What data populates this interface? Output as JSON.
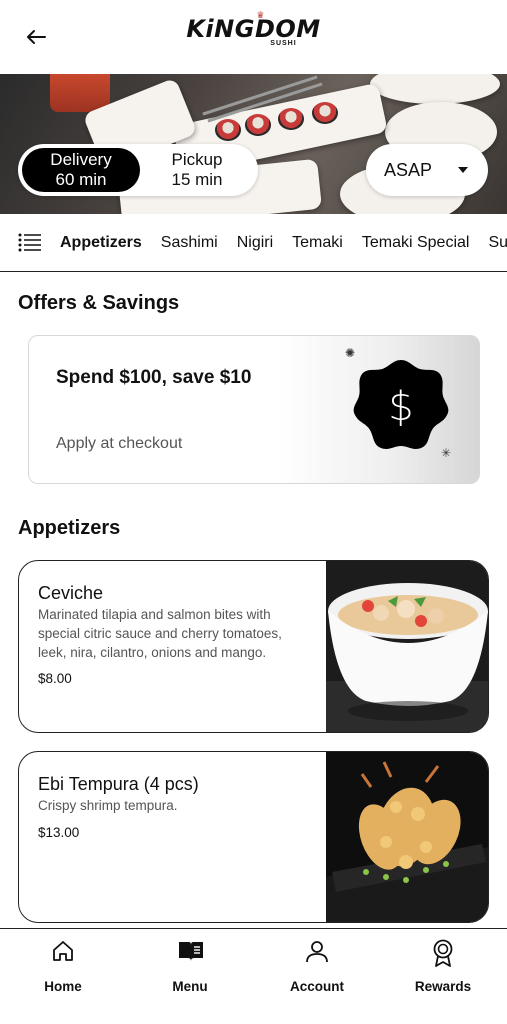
{
  "header": {
    "logo_text": "KiNGDOM",
    "logo_sub": "SUSHI"
  },
  "order_mode": {
    "delivery": {
      "label": "Delivery",
      "time": "60 min",
      "selected": true
    },
    "pickup": {
      "label": "Pickup",
      "time": "15 min",
      "selected": false
    },
    "schedule_value": "ASAP"
  },
  "categories": [
    "Appetizers",
    "Sashimi",
    "Nigiri",
    "Temaki",
    "Temaki Special",
    "Su"
  ],
  "active_category": "Appetizers",
  "offers": {
    "title": "Offers & Savings",
    "card": {
      "headline": "Spend $100, save $10",
      "subtext": "Apply at checkout",
      "badge_symbol": "$"
    }
  },
  "menu_section": {
    "title": "Appetizers",
    "items": [
      {
        "name": "Ceviche",
        "description": "Marinated tilapia and salmon bites with special citric sauce and cherry tomatoes, leek, nira, cilantro, onions and mango.",
        "price": "$8.00"
      },
      {
        "name": "Ebi Tempura (4 pcs)",
        "description": "Crispy shrimp tempura.",
        "price": "$13.00"
      }
    ]
  },
  "bottom_nav": [
    {
      "label": "Home",
      "icon": "home-icon"
    },
    {
      "label": "Menu",
      "icon": "book-icon"
    },
    {
      "label": "Account",
      "icon": "user-icon"
    },
    {
      "label": "Rewards",
      "icon": "award-icon"
    }
  ],
  "colors": {
    "primary": "#000000",
    "background": "#ffffff",
    "muted_text": "#555555"
  }
}
